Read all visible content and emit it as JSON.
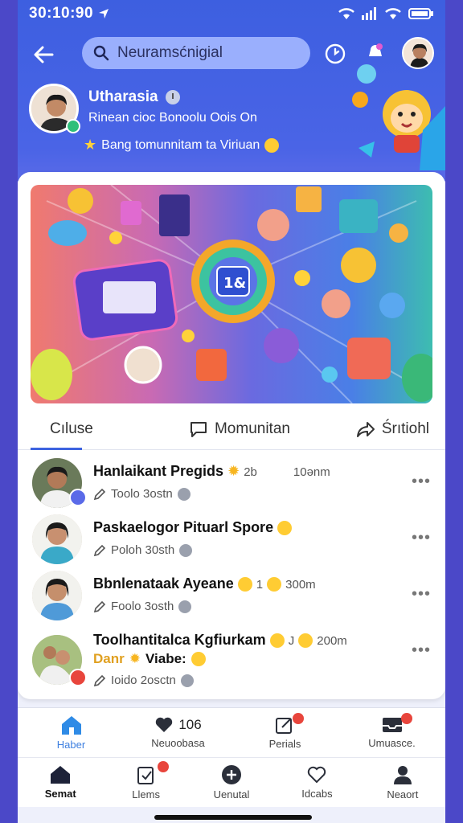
{
  "status": {
    "time": "30:10:90"
  },
  "topbar": {
    "search_value": "Neuramsćnigial"
  },
  "profile": {
    "name": "Utharasia",
    "subtitle": "Rinean cioc Bonoolu Oois On",
    "promo": "Bang tomunnitam ta Viriuan"
  },
  "tabs": [
    {
      "label": "Cıluse"
    },
    {
      "label": "Momunitan"
    },
    {
      "label": "Śrıtiohl"
    }
  ],
  "posts": [
    {
      "title": "Hanlaikant Pregids",
      "count": "2b",
      "time": "10ənm",
      "meta": "Toolo 3ostn"
    },
    {
      "title": "Paskaelogor Pituarl Spore",
      "count": "",
      "time": "",
      "meta": "Poloh 30sth"
    },
    {
      "title": "Bbnlenataak Ayeane",
      "count": "1",
      "time": "300m",
      "meta": "Foolo 3osth"
    },
    {
      "title": "Toolhantitalca Kgfiurkam",
      "count": "J",
      "time": "200m",
      "extra": "Danr",
      "extra2": "Viabe:",
      "meta": "Ioido 2osctn"
    }
  ],
  "nav1": [
    {
      "label": "Haber",
      "value": ""
    },
    {
      "label": "Neuoobasa",
      "value": "106"
    },
    {
      "label": "Perials",
      "value": ""
    },
    {
      "label": "Umuasce.",
      "value": ""
    }
  ],
  "nav2": [
    {
      "label": "Semat"
    },
    {
      "label": "Llems"
    },
    {
      "label": "Uenutal"
    },
    {
      "label": "Idcabs"
    },
    {
      "label": "Neaort"
    }
  ],
  "colors": {
    "accent": "#3d63e0",
    "header": "#4560e3",
    "badge": "#e8453c"
  }
}
